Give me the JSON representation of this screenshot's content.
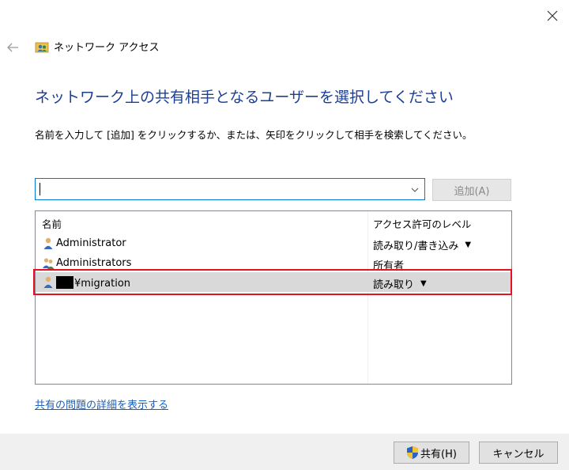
{
  "window": {
    "title": "ネットワーク アクセス",
    "close_icon": "close-icon",
    "back_icon": "back-arrow-icon"
  },
  "heading": "ネットワーク上の共有相手となるユーザーを選択してください",
  "instruction": "名前を入力して [追加] をクリックするか、または、矢印をクリックして相手を検索してください。",
  "input": {
    "value": "",
    "placeholder": ""
  },
  "add_button": "追加(A)",
  "list": {
    "headers": {
      "name": "名前",
      "permission": "アクセス許可のレベル"
    },
    "rows": [
      {
        "name": "Administrator",
        "permission": "読み取り/書き込み",
        "has_dropdown": true,
        "icon": "user-icon"
      },
      {
        "name": "Administrators",
        "permission": "所有者",
        "has_dropdown": false,
        "icon": "group-icon"
      },
      {
        "name": "¥migration",
        "permission": "読み取り",
        "has_dropdown": true,
        "icon": "user-icon",
        "selected": true
      }
    ]
  },
  "link": "共有の問題の詳細を表示する",
  "footer": {
    "share_button": "共有(H)",
    "cancel_button": "キャンセル"
  },
  "colors": {
    "heading": "#1c3f94",
    "link": "#1c5fb8",
    "highlight": "#e81123",
    "input_border": "#0078d7"
  }
}
